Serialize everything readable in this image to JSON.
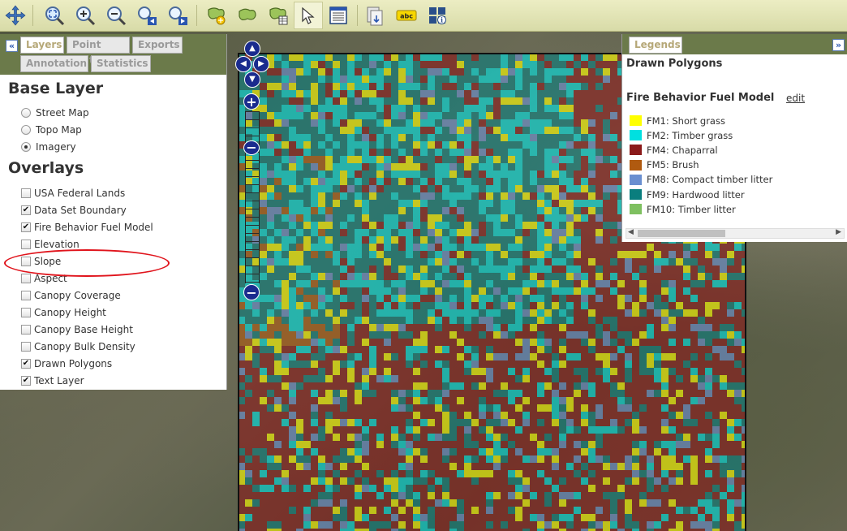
{
  "toolbar": {
    "tools": [
      {
        "name": "pan-icon"
      },
      {
        "name": "zoom-full-extent-icon"
      },
      {
        "name": "zoom-in-icon"
      },
      {
        "name": "zoom-out-icon"
      },
      {
        "name": "zoom-previous-icon"
      },
      {
        "name": "zoom-next-icon"
      },
      {
        "name": "draw-polygon-icon"
      },
      {
        "name": "edit-polygon-icon"
      },
      {
        "name": "polygon-table-icon"
      },
      {
        "name": "select-arrow-icon"
      },
      {
        "name": "identify-table-icon"
      },
      {
        "name": "export-map-icon"
      },
      {
        "name": "label-text-icon",
        "text": "abc"
      },
      {
        "name": "info-grid-icon"
      }
    ]
  },
  "left_panel": {
    "collapse_glyph": "«",
    "tabs": [
      "Layers",
      "Point Edit",
      "Exports",
      "Annotation",
      "Statistics"
    ],
    "active_tab": "Layers",
    "base_layer_title": "Base Layer",
    "base_layers": [
      {
        "label": "Street Map",
        "selected": false
      },
      {
        "label": "Topo Map",
        "selected": false
      },
      {
        "label": "Imagery",
        "selected": true
      }
    ],
    "overlays_title": "Overlays",
    "overlays": [
      {
        "label": "USA Federal Lands",
        "checked": false
      },
      {
        "label": "Data Set Boundary",
        "checked": true
      },
      {
        "label": "Fire Behavior Fuel Model",
        "checked": true
      },
      {
        "label": "Elevation",
        "checked": false
      },
      {
        "label": "Slope",
        "checked": false
      },
      {
        "label": "Aspect",
        "checked": false
      },
      {
        "label": "Canopy Coverage",
        "checked": false
      },
      {
        "label": "Canopy Height",
        "checked": false
      },
      {
        "label": "Canopy Base Height",
        "checked": false
      },
      {
        "label": "Canopy Bulk Density",
        "checked": false
      },
      {
        "label": "Drawn Polygons",
        "checked": true
      },
      {
        "label": "Text Layer",
        "checked": true
      }
    ],
    "check_glyph": "✔"
  },
  "map_controls": {
    "zoom_in": "+",
    "zoom_out": "−",
    "pan_up": "▲",
    "pan_down": "▼",
    "pan_left": "◀",
    "pan_right": "▶"
  },
  "legend_panel": {
    "tab": "Legends",
    "expand_glyph": "»",
    "drawn_polygons_title": "Drawn Polygons",
    "fuel_model_title": "Fire Behavior Fuel Model",
    "edit_link": "edit",
    "items": [
      {
        "label": "FM1: Short grass",
        "color": "#ffff00"
      },
      {
        "label": "FM2: Timber grass",
        "color": "#00e0e0"
      },
      {
        "label": "FM4: Chaparral",
        "color": "#8b1a1a"
      },
      {
        "label": "FM5: Brush",
        "color": "#b05a10"
      },
      {
        "label": "FM8: Compact timber litter",
        "color": "#6a8fd0"
      },
      {
        "label": "FM9: Hardwood litter",
        "color": "#0a7e7e"
      },
      {
        "label": "FM10: Timber litter",
        "color": "#7ec060"
      }
    ]
  },
  "colors": {
    "panel_header": "#6b7a4a",
    "nav_blue": "#1a2b8e",
    "highlight_red": "#e0141c"
  }
}
